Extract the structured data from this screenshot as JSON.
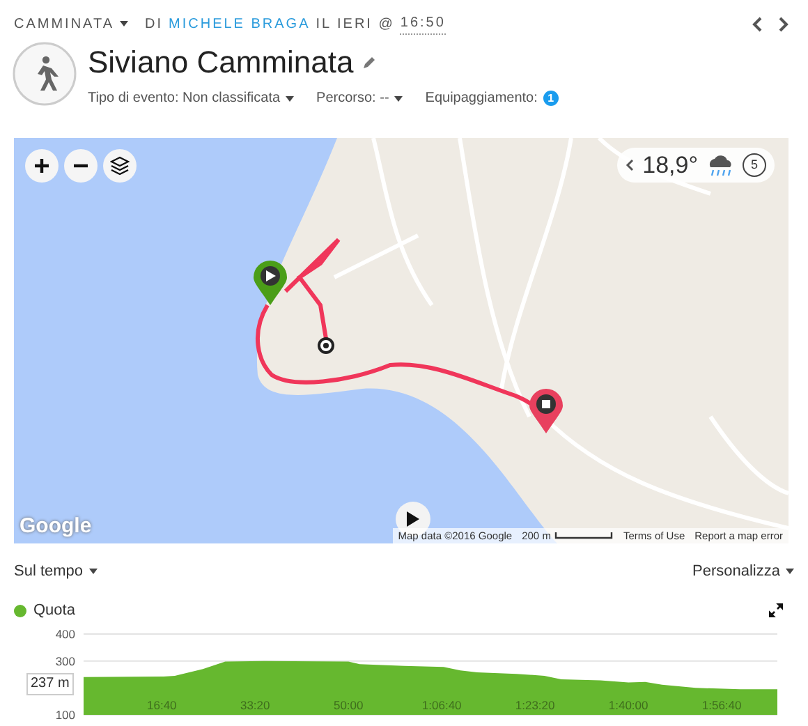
{
  "header": {
    "activity": "CAMMINATA",
    "by": "DI",
    "user": "MICHELE BRAGA",
    "when": "IL IERI @",
    "time": "16:50"
  },
  "title": "Siviano Camminata",
  "meta": [
    {
      "label": "Tipo di evento: Non classificata",
      "kind": "dropdown"
    },
    {
      "label": "Percorso: --",
      "kind": "dropdown"
    },
    {
      "label": "Equipaggiamento:",
      "kind": "count",
      "count": "1"
    }
  ],
  "map": {
    "kind": "picture",
    "weather": {
      "temperature": "18,9°",
      "timer": "5"
    },
    "logo": "Google",
    "attribution": [
      "Map data ©2016 Google",
      "200 m",
      "Terms of Use",
      "Report a map error"
    ]
  },
  "chart_controls": {
    "left": "Sul tempo",
    "right": "Personalizza"
  },
  "legend": {
    "color": "#66b82f"
  },
  "tooltip": "237 m",
  "chart_data": {
    "type": "area",
    "x": [
      2.7,
      17,
      19,
      24,
      28,
      35,
      50,
      52,
      60,
      67,
      70,
      73,
      80,
      85,
      88,
      95,
      100,
      103,
      106,
      112,
      120,
      126.6
    ],
    "series": [
      {
        "name": "Quota",
        "color": "#66b82f",
        "values": [
          240,
          242,
          245,
          270,
          298,
          300,
          298,
          288,
          282,
          278,
          265,
          258,
          252,
          245,
          232,
          228,
          220,
          222,
          212,
          200,
          195,
          195
        ]
      }
    ],
    "xticks": [
      {
        "value": 16.67,
        "label": "16:40"
      },
      {
        "value": 33.33,
        "label": "33:20"
      },
      {
        "value": 50,
        "label": "50:00"
      },
      {
        "value": 66.67,
        "label": "1:06:40"
      },
      {
        "value": 83.33,
        "label": "1:23:20"
      },
      {
        "value": 100,
        "label": "1:40:00"
      },
      {
        "value": 116.67,
        "label": "1:56:40"
      }
    ],
    "yticks": [
      100,
      300,
      400
    ],
    "ylim": [
      100,
      400
    ],
    "xlim": [
      2.7,
      126.6
    ]
  }
}
